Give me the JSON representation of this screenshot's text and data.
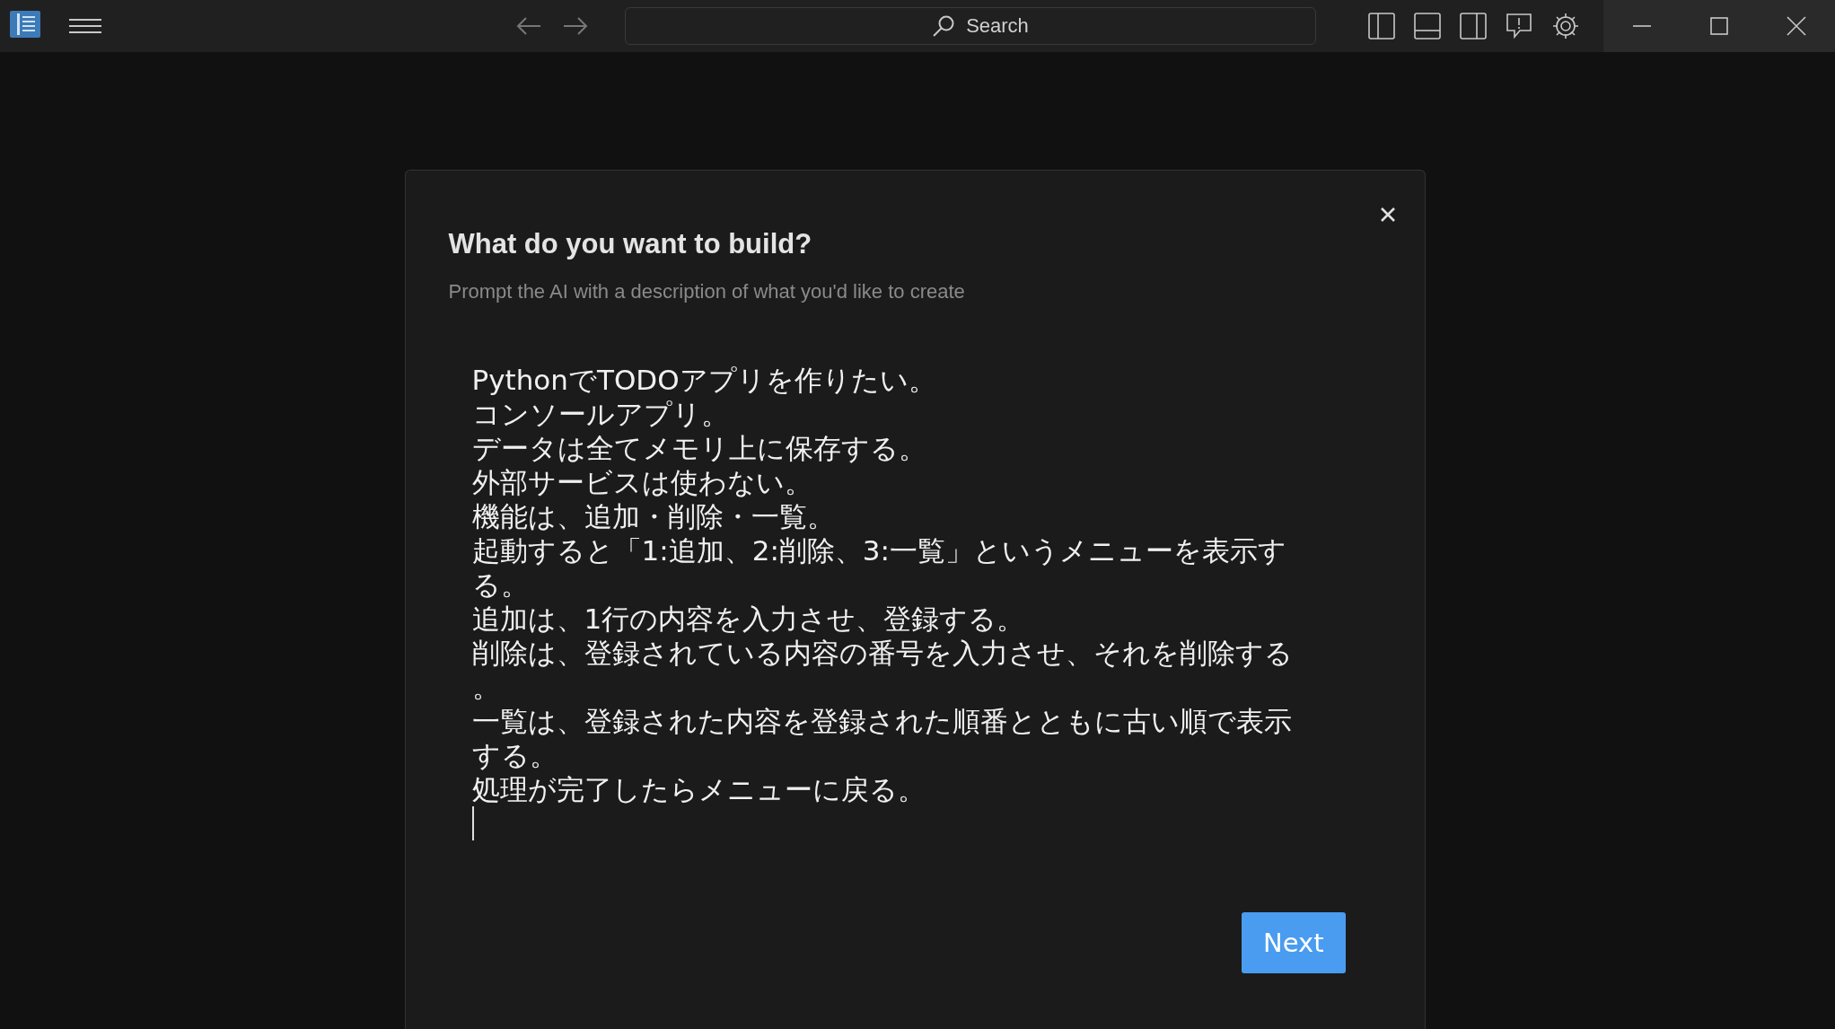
{
  "title_bar": {
    "search": {
      "placeholder": "Search"
    }
  },
  "dialog": {
    "title": "What do you want to build?",
    "subtitle": "Prompt the AI with a description of what you'd like to create",
    "prompt": {
      "lines": [
        "PythonでTODOアプリを作りたい。",
        "コンソールアプリ。",
        "データは全てメモリ上に保存する。",
        "外部サービスは使わない。",
        "機能は、追加・削除・一覧。",
        "起動すると「1:追加、2:削除、3:一覧」というメニューを表示する。",
        "追加は、1行の内容を入力させ、登録する。",
        "削除は、登録されている内容の番号を入力させ、それを削除する。",
        "一覧は、登録された内容を登録された順番とともに古い順で表示する。",
        "処理が完了したらメニューに戻る。"
      ]
    },
    "buttons": [
      "Next"
    ]
  }
}
